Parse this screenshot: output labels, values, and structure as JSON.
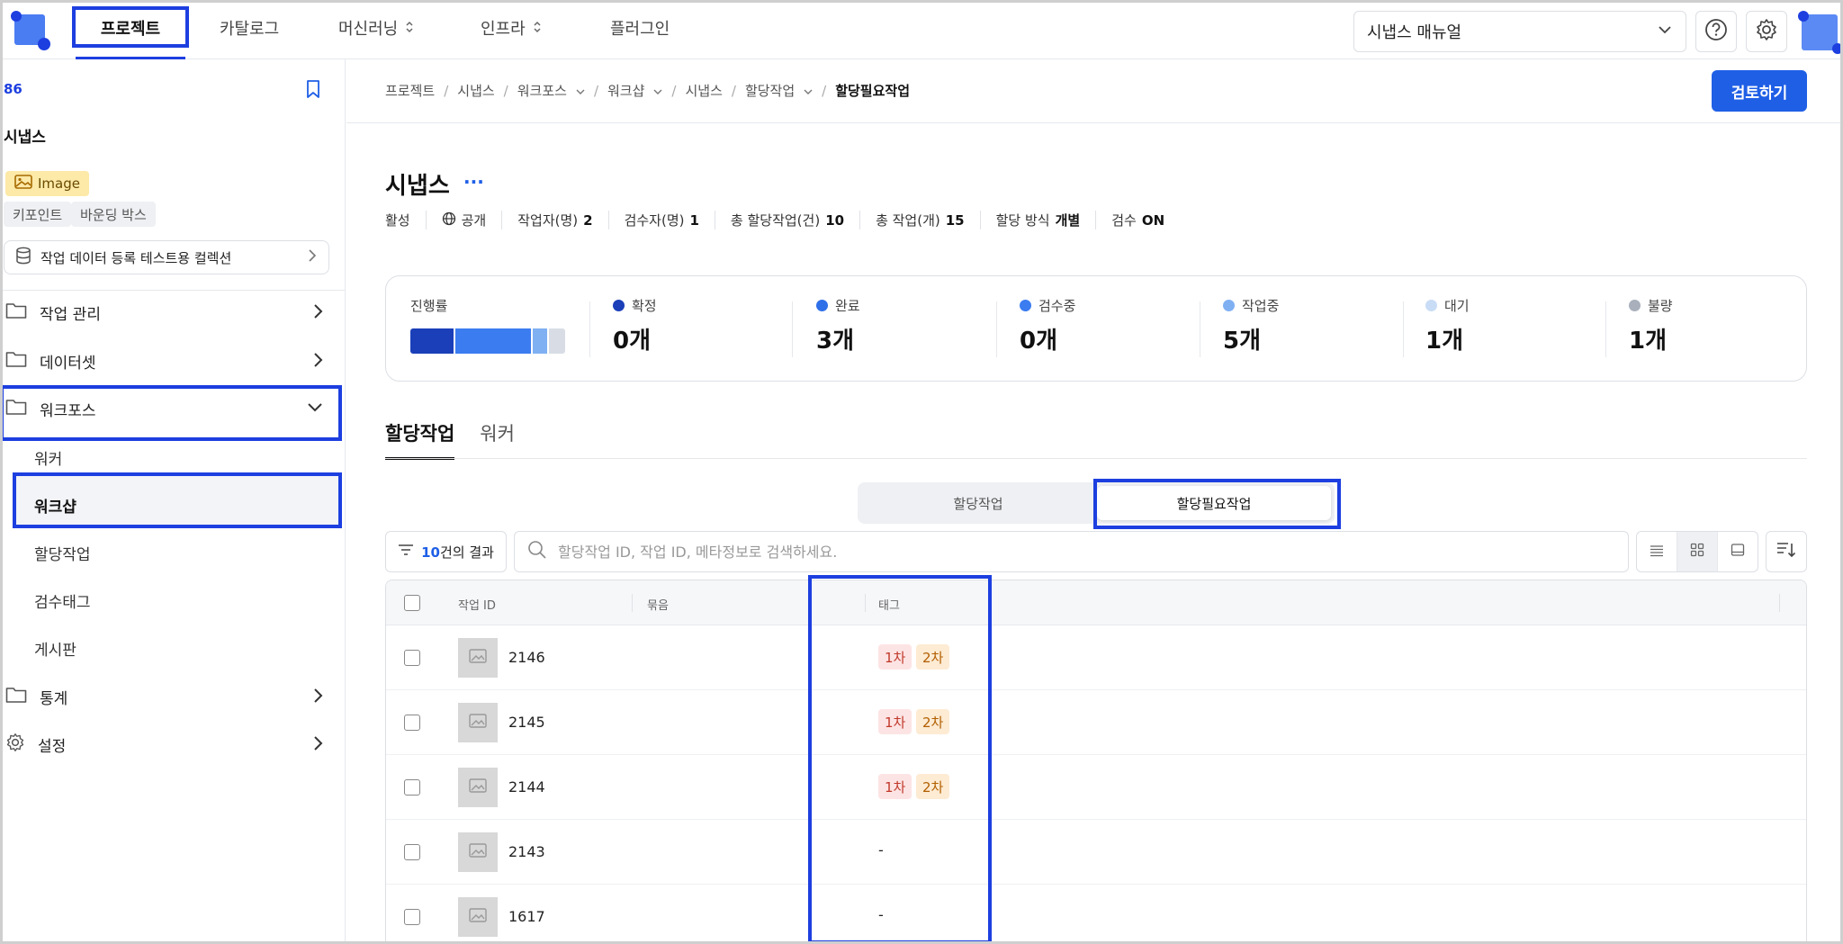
{
  "topnav": {
    "tabs": [
      {
        "label": "프로젝트"
      },
      {
        "label": "카탈로그"
      },
      {
        "label": "머신러닝"
      },
      {
        "label": "인프라"
      },
      {
        "label": "플러그인"
      }
    ],
    "manual_select": "시냅스 매뉴얼"
  },
  "sidebar": {
    "project_id": "86",
    "project_name": "시냅스",
    "data_type": "Image",
    "annotation_types": [
      "키포인트",
      "바운딩 박스"
    ],
    "collection": "작업 데이터 등록 테스트용 컬렉션",
    "menu": [
      {
        "label": "작업 관리"
      },
      {
        "label": "데이터셋"
      },
      {
        "label": "워크포스"
      },
      {
        "label": "통계"
      },
      {
        "label": "설정"
      }
    ],
    "workforce_sub": [
      {
        "label": "워커"
      },
      {
        "label": "워크샵"
      },
      {
        "label": "할당작업"
      },
      {
        "label": "검수태그"
      },
      {
        "label": "게시판"
      }
    ]
  },
  "breadcrumb": [
    "프로젝트",
    "시냅스",
    "워크포스",
    "워크샵",
    "시냅스",
    "할당작업",
    "할당필요작업"
  ],
  "review_button": "검토하기",
  "page": {
    "title": "시냅스",
    "more": "···",
    "meta": [
      {
        "label": "활성",
        "value": ""
      },
      {
        "label": "공개",
        "value": ""
      },
      {
        "label": "작업자(명)",
        "value": "2"
      },
      {
        "label": "검수자(명)",
        "value": "1"
      },
      {
        "label": "총 할당작업(건)",
        "value": "10"
      },
      {
        "label": "총 작업(개)",
        "value": "15"
      },
      {
        "label": "할당 방식",
        "value": "개별"
      },
      {
        "label": "검수",
        "value": "ON"
      }
    ]
  },
  "progress": {
    "label": "진행률",
    "stats": [
      {
        "label": "확정",
        "value": "0개",
        "color": "#1a3fb8"
      },
      {
        "label": "완료",
        "value": "3개",
        "color": "#2f6fe8"
      },
      {
        "label": "검수중",
        "value": "0개",
        "color": "#3b7cf0"
      },
      {
        "label": "작업중",
        "value": "5개",
        "color": "#7fb0f2"
      },
      {
        "label": "대기",
        "value": "1개",
        "color": "#c9dcf6"
      },
      {
        "label": "불량",
        "value": "1개",
        "color": "#a9b0bc"
      }
    ]
  },
  "tabs": [
    {
      "label": "할당작업"
    },
    {
      "label": "워커"
    }
  ],
  "segment": [
    {
      "label": "할당작업"
    },
    {
      "label": "할당필요작업"
    }
  ],
  "filter": {
    "count": "10",
    "suffix": "건의 결과"
  },
  "search": {
    "placeholder": "할당작업 ID, 작업 ID, 메타정보로 검색하세요."
  },
  "table": {
    "headers": {
      "id": "작업 ID",
      "group": "묶음",
      "tag": "태그"
    },
    "rows": [
      {
        "id": "2146",
        "tags": [
          "1차",
          "2차"
        ]
      },
      {
        "id": "2145",
        "tags": [
          "1차",
          "2차"
        ]
      },
      {
        "id": "2144",
        "tags": [
          "1차",
          "2차"
        ]
      },
      {
        "id": "2143",
        "tags": [],
        "empty": "-"
      },
      {
        "id": "1617",
        "tags": [],
        "empty": "-"
      }
    ]
  }
}
